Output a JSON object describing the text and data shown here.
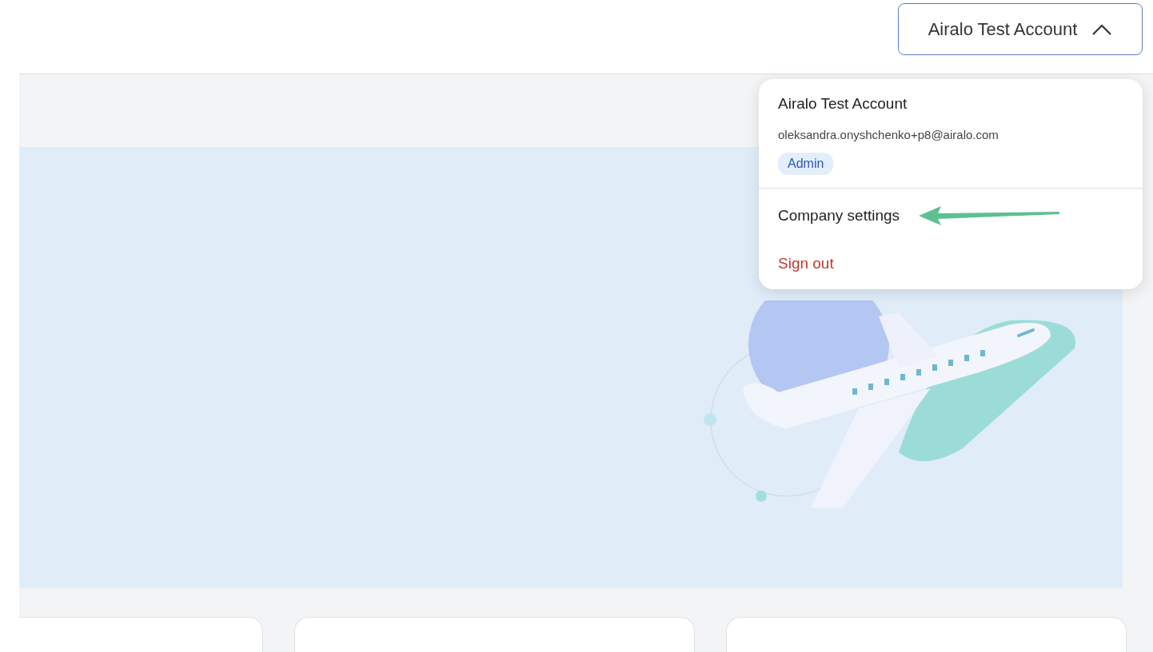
{
  "account_button": {
    "label": "Airalo Test Account",
    "expanded": true
  },
  "account_menu": {
    "name": "Airalo Test Account",
    "email": "oleksandra.onyshchenko+p8@airalo.com",
    "role_badge": "Admin",
    "items": [
      {
        "label": "Company settings",
        "kind": "normal"
      },
      {
        "label": "Sign out",
        "kind": "danger"
      }
    ]
  }
}
